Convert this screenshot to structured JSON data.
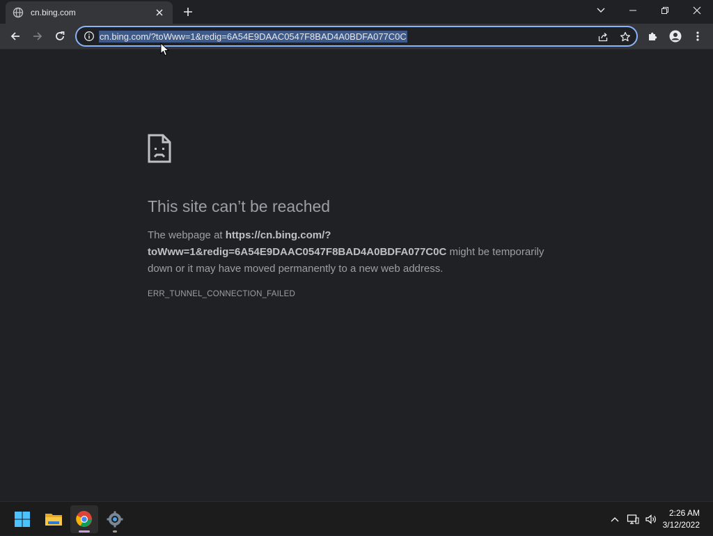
{
  "browser": {
    "tab": {
      "title": "cn.bing.com",
      "favicon": "globe-icon"
    },
    "address_bar": {
      "url": "cn.bing.com/?toWww=1&redig=6A54E9DAAC0547F8BAD4A0BDFA077C0C"
    }
  },
  "error_page": {
    "title": "This site can’t be reached",
    "body_prefix": "The webpage at ",
    "body_url": "https://cn.bing.com/?toWww=1&redig=6A54E9DAAC0547F8BAD4A0BDFA077C0C",
    "body_suffix": " might be temporarily down or it may have moved permanently to a new web address.",
    "error_code": "ERR_TUNNEL_CONNECTION_FAILED"
  },
  "taskbar": {
    "apps": [
      "start-icon",
      "file-explorer-icon",
      "chrome-icon",
      "settings-icon"
    ],
    "clock": {
      "time": "2:26 AM",
      "date": "3/12/2022"
    }
  },
  "colors": {
    "page_bg": "#202124",
    "toolbar_bg": "#35363a",
    "accent": "#8ab4f8",
    "text_muted": "#9aa0a6"
  }
}
